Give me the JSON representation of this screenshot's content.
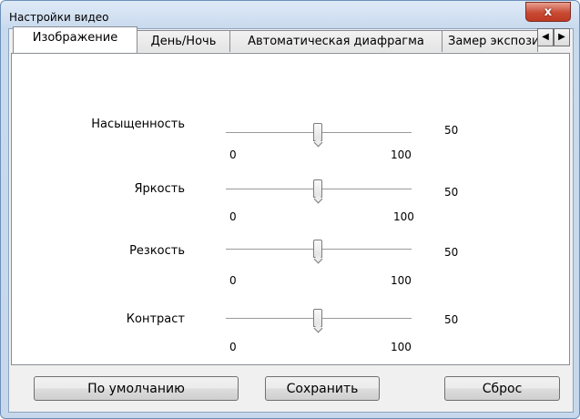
{
  "window": {
    "title": "Настройки видео",
    "close_glyph": "x"
  },
  "tabs": [
    {
      "label": "Изображение",
      "active": true
    },
    {
      "label": "День/Ночь",
      "active": false
    },
    {
      "label": "Автоматическая диафрагма",
      "active": false
    },
    {
      "label": "Замер экспозиции",
      "active": false
    }
  ],
  "tab_scroll": {
    "left_glyph": "◀",
    "right_glyph": "▶"
  },
  "sliders": [
    {
      "label": "Насыщенность",
      "min": "0",
      "max": "100",
      "value": "50"
    },
    {
      "label": "Яркость",
      "min": "0",
      "max": "100",
      "value": "50"
    },
    {
      "label": "Резкость",
      "min": "0",
      "max": "100",
      "value": "50"
    },
    {
      "label": "Контраст",
      "min": "0",
      "max": "100",
      "value": "50"
    }
  ],
  "buttons": {
    "default_label": "По умолчанию",
    "save_label": "Сохранить",
    "reset_label": "Сброс"
  }
}
